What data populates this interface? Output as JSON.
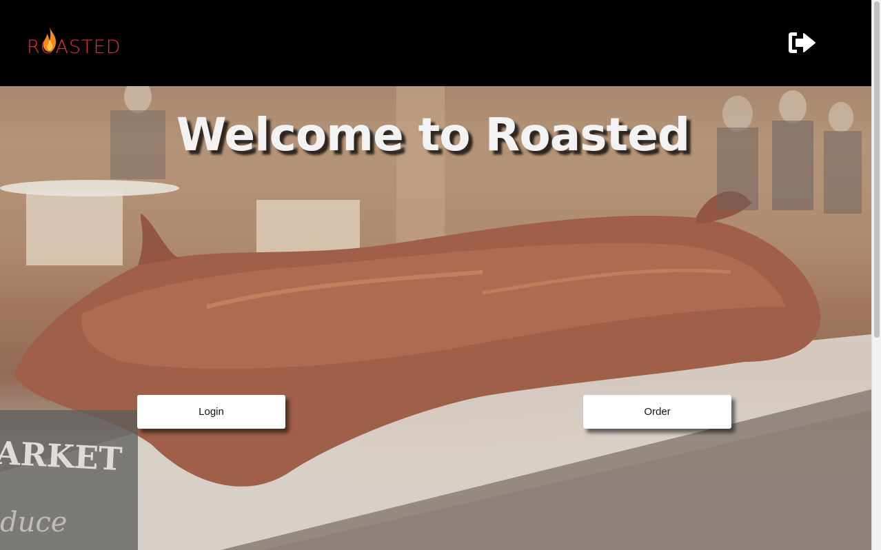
{
  "brand": {
    "logo_text": "ROASTED",
    "logo_color": "#e0303a",
    "flame_color": "#f08a1c"
  },
  "header": {
    "logout_icon": "sign-out-icon"
  },
  "hero": {
    "title": "Welcome to Roasted",
    "sign_text": "ARKET",
    "sign_subtext": "duce"
  },
  "actions": {
    "login_label": "Login",
    "order_label": "Order"
  }
}
